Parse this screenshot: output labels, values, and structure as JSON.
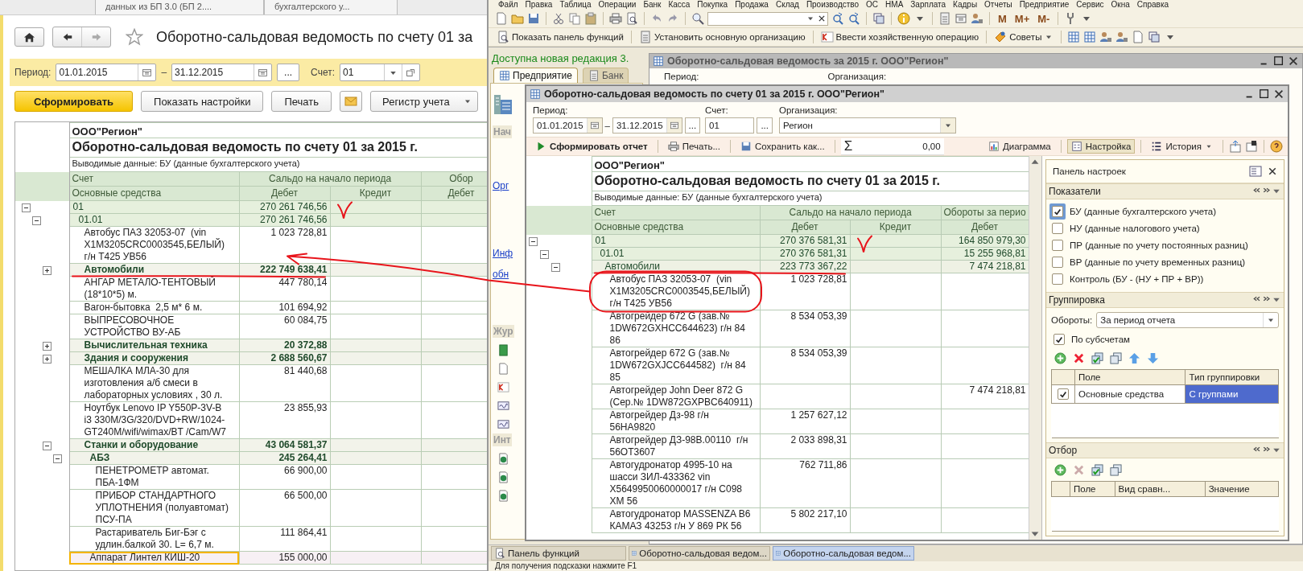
{
  "left_app": {
    "top_tabs": [
      {
        "label": "данных из БП 3.0 (БП 2....",
        "selected": false
      },
      {
        "label": "бухгалтерского у...",
        "selected": false
      }
    ],
    "title": "Оборотно-сальдовая ведомость по счету 01 за",
    "filters": {
      "period_label": "Период:",
      "date_from": "01.01.2015",
      "dash": "–",
      "date_to": "31.12.2015",
      "more": "...",
      "account_label": "Счет:",
      "account": "01"
    },
    "buttons": [
      {
        "label": "Сформировать",
        "kind": "primary"
      },
      {
        "label": "Показать настройки",
        "kind": "plain"
      },
      {
        "label": "Печать",
        "kind": "plain"
      },
      {
        "kind": "mail"
      },
      {
        "label": "Регистр учета",
        "kind": "dropdown"
      }
    ],
    "report": {
      "org": "ООО\"Регион\"",
      "title": "Оборотно-сальдовая ведомость по счету 01 за 2015 г.",
      "output": "Выводимые данные:  БУ (данные бухгалтерского учета)",
      "header_top": [
        "Счет",
        "Сальдо на начало периода",
        "Обор"
      ],
      "header_bottom": [
        "Основные средства",
        "Дебет",
        "Кредит",
        "Дебет"
      ],
      "rows": [
        {
          "kind": "account",
          "name": "01",
          "debit": "270 261 746,56",
          "expanded": true,
          "selected": false,
          "children": [
            {
              "kind": "account",
              "name": "01.01",
              "debit": "270 261 746,56",
              "expanded": true,
              "selected": false,
              "children": [
                {
                  "kind": "item",
                  "name": "Автобус ПАЗ 32053-07  (vin X1M3205CRC0003545,БЕЛЫЙ) г/н Т425 УВ56",
                  "debit": "1 023 728,81",
                  "selected": false
                },
                {
                  "kind": "group",
                  "name": "Автомобили",
                  "debit": "222 749 638,41",
                  "expanded": false,
                  "selected": false
                },
                {
                  "kind": "item",
                  "name": "АНГАР МЕТАЛО-ТЕНТОВЫЙ (18*10*5) м.",
                  "debit": "447 780,14",
                  "selected": false
                },
                {
                  "kind": "item",
                  "name": "Вагон-бытовка  2,5 м* 6 м.",
                  "debit": "101 694,92",
                  "selected": false
                },
                {
                  "kind": "item",
                  "name": "ВЫПРЕСОВОЧНОЕ УСТРОЙСТВО ВУ-АБ",
                  "debit": "60 084,75",
                  "selected": false
                },
                {
                  "kind": "group",
                  "name": "Вычислительная техника",
                  "debit": "20 372,88",
                  "expanded": false,
                  "selected": false
                },
                {
                  "kind": "group",
                  "name": "Здания и сооружения",
                  "debit": "2 688 560,67",
                  "expanded": false,
                  "selected": false
                },
                {
                  "kind": "item",
                  "name": "МЕШАЛКА МЛА-30 для изготовления а/б смеси в лабораторных условиях , 30 л.",
                  "debit": "81 440,68",
                  "selected": false
                },
                {
                  "kind": "item",
                  "name": "Ноутбук Lenovo IP Y550P-3V-B  i3 330M/3G/320/DVD+RW/1024-GT240M/wifi/wimax/BT /Cam/W7",
                  "debit": "23 855,93",
                  "selected": false
                },
                {
                  "kind": "group",
                  "name": "Станки и оборудование",
                  "debit": "43 064 581,37",
                  "expanded": true,
                  "selected": false,
                  "children": [
                    {
                      "kind": "group",
                      "name": "АБЗ",
                      "debit": "245 264,41",
                      "expanded": true,
                      "selected": false,
                      "children": [
                        {
                          "kind": "item",
                          "name": "ПЕНЕТРОМЕТР автомат. ПБА-1ФМ",
                          "debit": "66 900,00",
                          "selected": false
                        },
                        {
                          "kind": "item",
                          "name": "ПРИБОР СТАНДАРТНОГО УПЛОТНЕНИЯ (полуавтомат) ПСУ-ПА",
                          "debit": "66 500,00",
                          "selected": false
                        },
                        {
                          "kind": "item",
                          "name": "Растариватель Биг-Бэг с удлин.балкой 30. L= 6,7 м.",
                          "debit": "111 864,41",
                          "selected": false
                        }
                      ]
                    },
                    {
                      "kind": "item",
                      "name": "Аппарат Линтел КИШ-20",
                      "debit": "155 000,00",
                      "selected": true
                    }
                  ]
                }
              ]
            }
          ]
        }
      ]
    }
  },
  "right_app": {
    "menu": [
      "Файл",
      "Правка",
      "Таблица",
      "Операции",
      "Банк",
      "Касса",
      "Покупка",
      "Продажа",
      "Склад",
      "Производство",
      "ОС",
      "НМА",
      "Зарплата",
      "Кадры",
      "Отчеты",
      "Предприятие",
      "Сервис",
      "Окна",
      "Справка"
    ],
    "memory_buttons": [
      "M",
      "M+",
      "M-"
    ],
    "actions": [
      "Показать панель функций",
      "Установить основную организацию",
      "Ввести хозяйственную операцию",
      "Советы"
    ],
    "notice": "Доступна новая редакция 3.",
    "side_tabs": [
      {
        "label": "Предприятие",
        "selected": true
      },
      {
        "label": "Банк",
        "selected": false
      }
    ],
    "side_items": [
      {
        "kind": "header",
        "text": "Нач"
      },
      {
        "kind": "link",
        "text": "Орг"
      },
      {
        "kind": "link",
        "text": "Инф"
      },
      {
        "kind": "link",
        "text": "обн"
      },
      {
        "kind": "header",
        "text": "Жур"
      },
      {
        "kind": "header",
        "text": "Инт"
      }
    ],
    "back_window": {
      "title": "Оборотно-сальдовая ведомость за 2015 г. ООО\"Регион\"",
      "labels": [
        "Период:",
        "Организация:"
      ]
    },
    "window": {
      "title": "Оборотно-сальдовая ведомость по счету 01 за 2015 г. ООО\"Регион\"",
      "period_label": "Период:",
      "date_from": "01.01.2015",
      "dash": "–",
      "date_to": "31.12.2015",
      "more": "...",
      "account_label": "Счет:",
      "account": "01",
      "org_label": "Организация:",
      "org": "Регион",
      "toolbar": {
        "left": [
          {
            "label": "Сформировать отчет",
            "kind": "run"
          },
          {
            "label": "Печать...",
            "kind": "print"
          },
          {
            "label": "Сохранить как...",
            "kind": "save"
          }
        ],
        "sum_sign": "Σ",
        "sum_value": "0,00",
        "right": [
          {
            "label": "Диаграмма",
            "kind": "chart",
            "pressed": false
          },
          {
            "label": "Настройка",
            "kind": "settings",
            "pressed": true
          },
          {
            "label": "История",
            "kind": "history",
            "pressed": false
          }
        ]
      },
      "report": {
        "org": "ООО\"Регион\"",
        "title": "Оборотно-сальдовая ведомость по счету 01 за 2015 г.",
        "output": "Выводимые данные:  БУ (данные бухгалтерского учета)",
        "header_top": [
          "Счет",
          "Сальдо на начало периода",
          "Обороты за перио"
        ],
        "header_bottom": [
          "Основные средства",
          "Дебет",
          "Кредит",
          "Дебет"
        ],
        "rows": [
          {
            "kind": "account",
            "name": "01",
            "debit": "270 376 581,31",
            "turnover_debit": "164 850 979,30",
            "expanded": true,
            "selected": false,
            "children": [
              {
                "kind": "account",
                "name": "01.01",
                "debit": "270 376 581,31",
                "turnover_debit": "15 255 968,81",
                "expanded": true,
                "selected": false,
                "children": [
                  {
                    "kind": "group",
                    "name": "Автомобили",
                    "debit": "223 773 367,22",
                    "turnover_debit": "7 474 218,81",
                    "expanded": true,
                    "selected": false,
                    "children": [
                      {
                        "kind": "item",
                        "name": "Автобус ПАЗ 32053-07  (vin X1M3205CRC0003545,БЕЛЫЙ) г/н Т425 УВ56",
                        "debit": "1 023 728,81",
                        "selected": false
                      },
                      {
                        "kind": "item",
                        "name": "Автогрейдер 672 G (зав.№ 1DW672GXHCC644623) г/н 84 86",
                        "debit": "8 534 053,39",
                        "selected": false
                      },
                      {
                        "kind": "item",
                        "name": "Автогрейдер 672 G (зав.№ 1DW672GXJCC644582)  г/н 84 85",
                        "debit": "8 534 053,39",
                        "selected": false
                      },
                      {
                        "kind": "item",
                        "name": "Автогрейдер John Deer 872 G (Сер.№ 1DW872GXPBC640911)",
                        "turnover_debit": "7 474 218,81",
                        "selected": false
                      },
                      {
                        "kind": "item",
                        "name": "Автогрейдер Дз-98 г/н 56НА9820",
                        "debit": "1 257 627,12",
                        "selected": false
                      },
                      {
                        "kind": "item",
                        "name": "Автогрейдер ДЗ-98В.00110  г/н 56ОТ3607",
                        "debit": "2 033 898,31",
                        "selected": false
                      },
                      {
                        "kind": "item",
                        "name": "Автогудронатор 4995-10 на шасси ЗИЛ-433362 vin X5649950060000017 г/н С098 ХМ 56",
                        "debit": "762 711,86",
                        "selected": false
                      },
                      {
                        "kind": "item",
                        "name": "Автогудронатор MASSENZA B6 КАМАЗ 43253 г/н У 869 РК 56",
                        "debit": "5 802 217,10",
                        "selected": false
                      }
                    ]
                  }
                ]
              }
            ]
          }
        ]
      },
      "settings": {
        "title": "Панель настроек",
        "indicators": {
          "title": "Показатели",
          "items": [
            {
              "label": "БУ (данные бухгалтерского учета)",
              "checked": true,
              "selected": true
            },
            {
              "label": "НУ (данные налогового учета)",
              "checked": false,
              "selected": false
            },
            {
              "label": "ПР (данные по учету постоянных разниц)",
              "checked": false,
              "selected": false
            },
            {
              "label": "ВР (данные по учету временных разниц)",
              "checked": false,
              "selected": false
            },
            {
              "label": "Контроль (БУ - (НУ + ПР + ВР))",
              "checked": false,
              "selected": false
            }
          ]
        },
        "grouping": {
          "title": "Группировка",
          "turnover_label": "Обороты:",
          "turnover_value": "За период отчета",
          "subaccounts": {
            "label": "По субсчетам",
            "checked": true
          },
          "columns": [
            "Поле",
            "Тип группировки"
          ],
          "rows": [
            {
              "checked": true,
              "field": "Основные средства",
              "type": "С группами",
              "selected": true
            }
          ]
        },
        "filter": {
          "title": "Отбор",
          "columns": [
            "Поле",
            "Вид сравн...",
            "Значение"
          ]
        }
      }
    },
    "taskbar": [
      {
        "label": "Панель функций",
        "selected": false
      },
      {
        "label": "Оборотно-сальдовая ведом...",
        "selected": false
      },
      {
        "label": "Оборотно-сальдовая ведом...",
        "selected": true
      }
    ],
    "status": "Для получения подсказки нажмите F1"
  }
}
